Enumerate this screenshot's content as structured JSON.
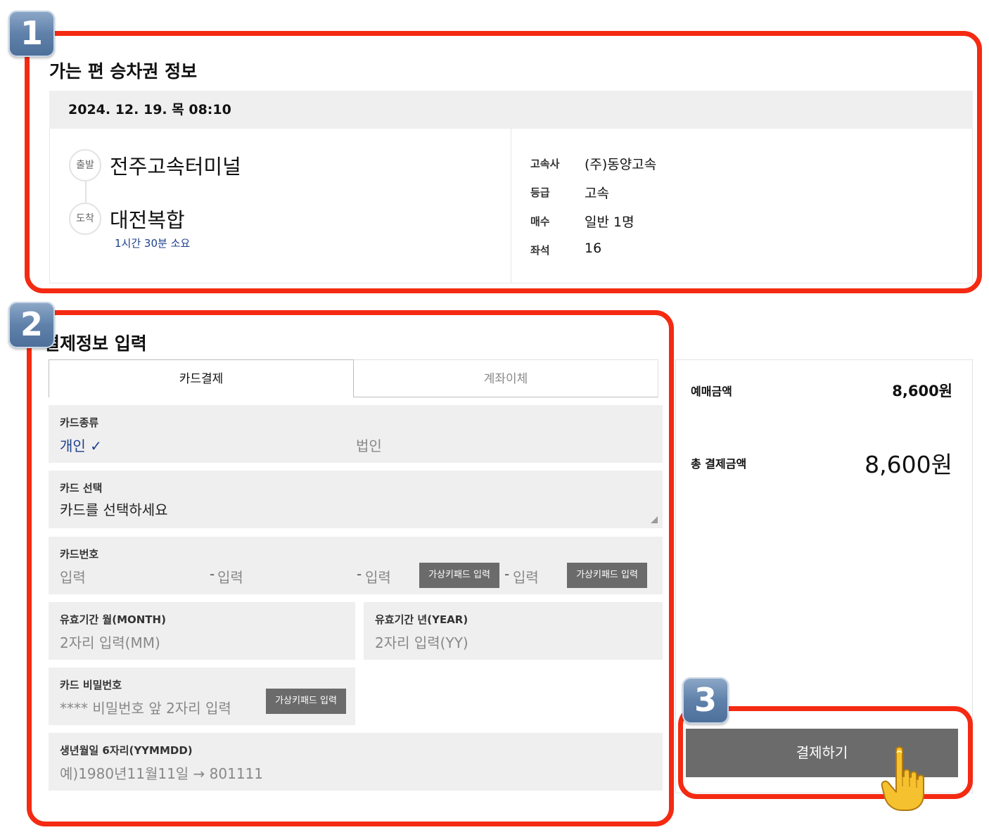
{
  "markers": [
    "1",
    "2",
    "3"
  ],
  "outbound": {
    "section_title": "가는 편 승차권 정보",
    "datetime": "2024. 12. 19. 목 08:10",
    "departure": {
      "tag": "출발",
      "station": "전주고속터미널"
    },
    "arrival": {
      "tag": "도착",
      "station": "대전복합"
    },
    "duration": "1시간 30분 소요",
    "info": [
      {
        "key": "고속사",
        "value": "(주)동양고속"
      },
      {
        "key": "등급",
        "value": "고속"
      },
      {
        "key": "매수",
        "value": "일반 1명"
      },
      {
        "key": "좌석",
        "value": "16"
      }
    ]
  },
  "payment": {
    "section_title": "결제정보 입력",
    "tabs": [
      {
        "label": "카드결제",
        "active": true
      },
      {
        "label": "계좌이체",
        "active": false
      }
    ],
    "card_type": {
      "label": "카드종류",
      "options": [
        "개인",
        "법인"
      ],
      "selected": "개인",
      "check": "✓"
    },
    "card_select": {
      "label": "카드 선택",
      "placeholder": "카드를 선택하세요"
    },
    "card_number": {
      "label": "카드번호",
      "placeholders": [
        "입력",
        "입력",
        "입력",
        "입력"
      ],
      "separator": "-",
      "virtual_keypad_label": "가상키패드 입력"
    },
    "expiry_month": {
      "label": "유효기간 월(MONTH)",
      "placeholder": "2자리 입력(MM)"
    },
    "expiry_year": {
      "label": "유효기간 년(YEAR)",
      "placeholder": "2자리 입력(YY)"
    },
    "card_password": {
      "label": "카드 비밀번호",
      "placeholder": "**** 비밀번호 앞 2자리 입력",
      "virtual_keypad_label": "가상키패드 입력"
    },
    "birth": {
      "label": "생년월일 6자리(YYMMDD)",
      "placeholder": "예)1980년11월11일 → 801111"
    }
  },
  "summary": {
    "fare_label": "예매금액",
    "fare_value": "8,600원",
    "total_label": "총 결제금액",
    "total_value": "8,600원",
    "pay_button": "결제하기"
  },
  "colors": {
    "accent_blue": "#1d3f8c",
    "annotation_red": "#f42a12",
    "button_gray": "#6b6b6b"
  }
}
